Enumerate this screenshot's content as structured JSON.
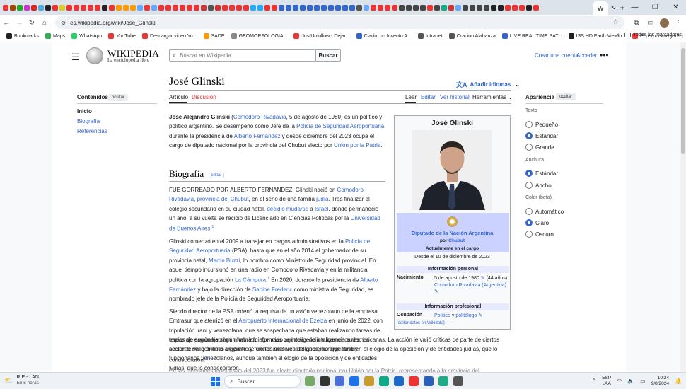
{
  "browser": {
    "tab_colors": [
      "#e33",
      "#a40",
      "#2a2",
      "#c3c",
      "#d22",
      "#5ad",
      "#222",
      "#e33",
      "#dc2",
      "#e33",
      "#e33",
      "#e33",
      "#e33",
      "#e33",
      "#222",
      "#e33",
      "#f90",
      "#f90",
      "#f90",
      "#6af",
      "#e33",
      "#6af",
      "#e33",
      "#e33",
      "#e33",
      "#e33",
      "#e33",
      "#e33",
      "#c33",
      "#555",
      "#c33",
      "#e33",
      "#e33",
      "#e33",
      "#e33",
      "#2af",
      "#2af",
      "#e33",
      "#e33",
      "#36c",
      "#36c",
      "#36c",
      "#36c",
      "#36c",
      "#36c",
      "#36c",
      "#36c",
      "#36c",
      "#36c",
      "#36c",
      "#555",
      "#6af",
      "#e33",
      "#e33",
      "#e33",
      "#e33",
      "#444",
      "#444",
      "#444",
      "#444",
      "#e33",
      "#444",
      "#1a8",
      "#c33",
      "#6af",
      "#444",
      "#444",
      "#444",
      "#444",
      "#222",
      "#222",
      "#e33",
      "#e33",
      "#e33",
      "#222",
      "#e33"
    ],
    "active_tab_glyph": "W",
    "close_glyph": "✕",
    "newtab_glyph": "+",
    "window_controls": [
      "⌄",
      "—",
      "❐",
      "✕"
    ],
    "url": "es.wikipedia.org/wiki/José_Glinski",
    "bookmarks": [
      {
        "label": "Bookmarks",
        "color": "#222"
      },
      {
        "label": "Maps",
        "color": "#34a853"
      },
      {
        "label": "WhatsApp",
        "color": "#25d366"
      },
      {
        "label": "YouTube",
        "color": "#e33"
      },
      {
        "label": "Descargar video Yo...",
        "color": "#e33"
      },
      {
        "label": "SADE",
        "color": "#f90"
      },
      {
        "label": "GEOMORFOLOGIA...",
        "color": "#888"
      },
      {
        "label": "JustUnfollow - Dejar...",
        "color": "#e33"
      },
      {
        "label": "Clarín, un Invento A...",
        "color": "#36c"
      },
      {
        "label": "Intranet",
        "color": "#555"
      },
      {
        "label": "Oracion Alabanza",
        "color": "#555"
      },
      {
        "label": "LIVE REAL TIME SAT...",
        "color": "#36c"
      },
      {
        "label": "ISS HD Earth Viewin...",
        "color": "#222"
      },
      {
        "label": "El peronismo y los j...",
        "color": "#e33"
      }
    ],
    "more_bookmarks": "»",
    "all_bookmarks": "Todos los marcadores"
  },
  "wiki": {
    "logo_title": "Wikipedia",
    "logo_tagline": "La enciclopedia libre",
    "search_placeholder": "Buscar en Wikipedia",
    "search_button": "Buscar",
    "create_account": "Crear una cuenta",
    "login": "Acceder",
    "toc_title": "Contenidos",
    "hide": "ocultar",
    "toc": [
      "Inicio",
      "Biografía",
      "Referencias"
    ],
    "page_title": "José Glinski",
    "add_languages": "Añadir idiomas",
    "tabs_left": [
      "Artículo",
      "Discusión"
    ],
    "tabs_right": [
      "Leer",
      "Editar",
      "Ver historial",
      "Herramientas"
    ],
    "appearance": {
      "title": "Apariencia",
      "hide": "ocultar",
      "text_label": "Texto",
      "text_options": [
        "Pequeño",
        "Estándar",
        "Grande"
      ],
      "text_selected": "Estándar",
      "width_label": "Anchura",
      "width_options": [
        "Estándar",
        "Ancho"
      ],
      "width_selected": "Estándar",
      "color_label": "Color (beta)",
      "color_options": [
        "Automático",
        "Claro",
        "Oscuro"
      ],
      "color_selected": "Claro"
    },
    "lead": {
      "name": "José Alejandro Glinski",
      "t1": " (",
      "link1": "Comodoro Rivadavia",
      "t2": ", 5 de agosto de 1980) es un político y político argentino. Se desempeñó como Jefe de la ",
      "link2": "Policía de Seguridad Aeroportuaria",
      "t3": " durante la presidencia de ",
      "link3": "Alberto Fernández",
      "t4": " y desde diciembre del 2023 ocupa el cargo de diputado nacional por la provincia del Chubut electo por ",
      "link4": "Unión por la Patria",
      "t5": "."
    },
    "section_bio": "Biografía",
    "section_edit": "[ editar ]",
    "p1": {
      "t1": "FUE GORREADO POR ALBERTO FERNANDEZ. Glinski nació en ",
      "link1": "Comodoro Rivadavia, provincia del Chubut",
      "t2": ", en el seno de una familia ",
      "link2": "judía",
      "t3": ". Tras finalizar el colegio secundario en su ciudad natal, ",
      "link3": "decidió mudarse",
      "t4": " a ",
      "link4": "Israel",
      "t5": ", donde permaneció un año, a su vuelta se recibió de Licenciado en Ciencias Políticas por la ",
      "link5": "Universidad de Buenos Aires",
      "t6": ".",
      "ref": "1"
    },
    "p2": {
      "t1": "Glinski comenzó en el 2009 a trabajar en cargos administrativos en la ",
      "link1": "Policía de Seguridad Aeroportuaria",
      "t2": " (PSA), hasta que en el año 2014 el gobernador de su provincia natal, ",
      "link2": "Martín Buzzi",
      "t3": ", lo nombró como Ministro de Seguridad provincial. En aquel tiempo incursionó en una radio en Comodoro Rivadavia y en la militancia política con la agrupación ",
      "link3": "La Cámpora",
      "t4": ".",
      "ref1": "1",
      "t5": " En 2020, durante la presidencia de ",
      "link4": "Alberto Fernández",
      "t6": " y bajo la dirección de ",
      "link5": "Sabina Frederic",
      "t7": " como ministra de Seguridad, es nombrado jefe de la Policía de Seguridad Aeroportuaria."
    },
    "p3": {
      "t1": "Siendo director de la PSA ordenó la requisa de un avión venezolano de la empresa Emtrasur que aterrizó en el ",
      "link1": "Aeropuerto Internacional de Ezeiza",
      "t2": " en junio de 2022, con tripulación iraní y venezolana, que se sospechaba que estaban realizando tareas de espionaje según habrían informado agencias de inteligencia sudamericanas. La acción le valió críticas de parte de ciertos sectores del gobierno argentino y funcionarios venezolanos, aunque también el elogio de la oposición y de entidades judías, que lo condecoraron.",
      "refs": "2 3"
    },
    "p4_partial": "En las elecciones legislativas del 2023 fue electo diputado nacional por Unión por la Patria, representando a la provincia del",
    "infobox": {
      "title": "José Glinski",
      "role": "Diputado de la Nación Argentina",
      "por_label": "por",
      "por_link": "Chubut",
      "status": "Actualmente en el cargo",
      "since": "Desde el 10 de diciembre de 2023",
      "section1": "Información personal",
      "birth_key": "Nacimiento",
      "birth_val": "5 de agosto de 1980",
      "birth_age": "(44 años)",
      "birth_place": "Comodoro Rivadavia (Argentina)",
      "section2": "Información profesional",
      "occ_key": "Ocupación",
      "occ_val1": "Político",
      "occ_sep": " y ",
      "occ_val2": "politólogo",
      "edit": "[editar datos en Wikidata]"
    }
  },
  "taskbar": {
    "weather_title": "RIE - LAN",
    "weather_sub": "En 5 horas",
    "search": "Buscar",
    "app_colors": [
      "#7a6",
      "#333",
      "#4a6fd8",
      "#1a73e8",
      "#c89b2a",
      "#1a8",
      "#1b6ac9",
      "#e33",
      "#2b5eb8",
      "#2a8",
      "#555"
    ],
    "lang": "ESP",
    "region": "LAA",
    "time": "10:24",
    "date": "9/8/2024"
  }
}
